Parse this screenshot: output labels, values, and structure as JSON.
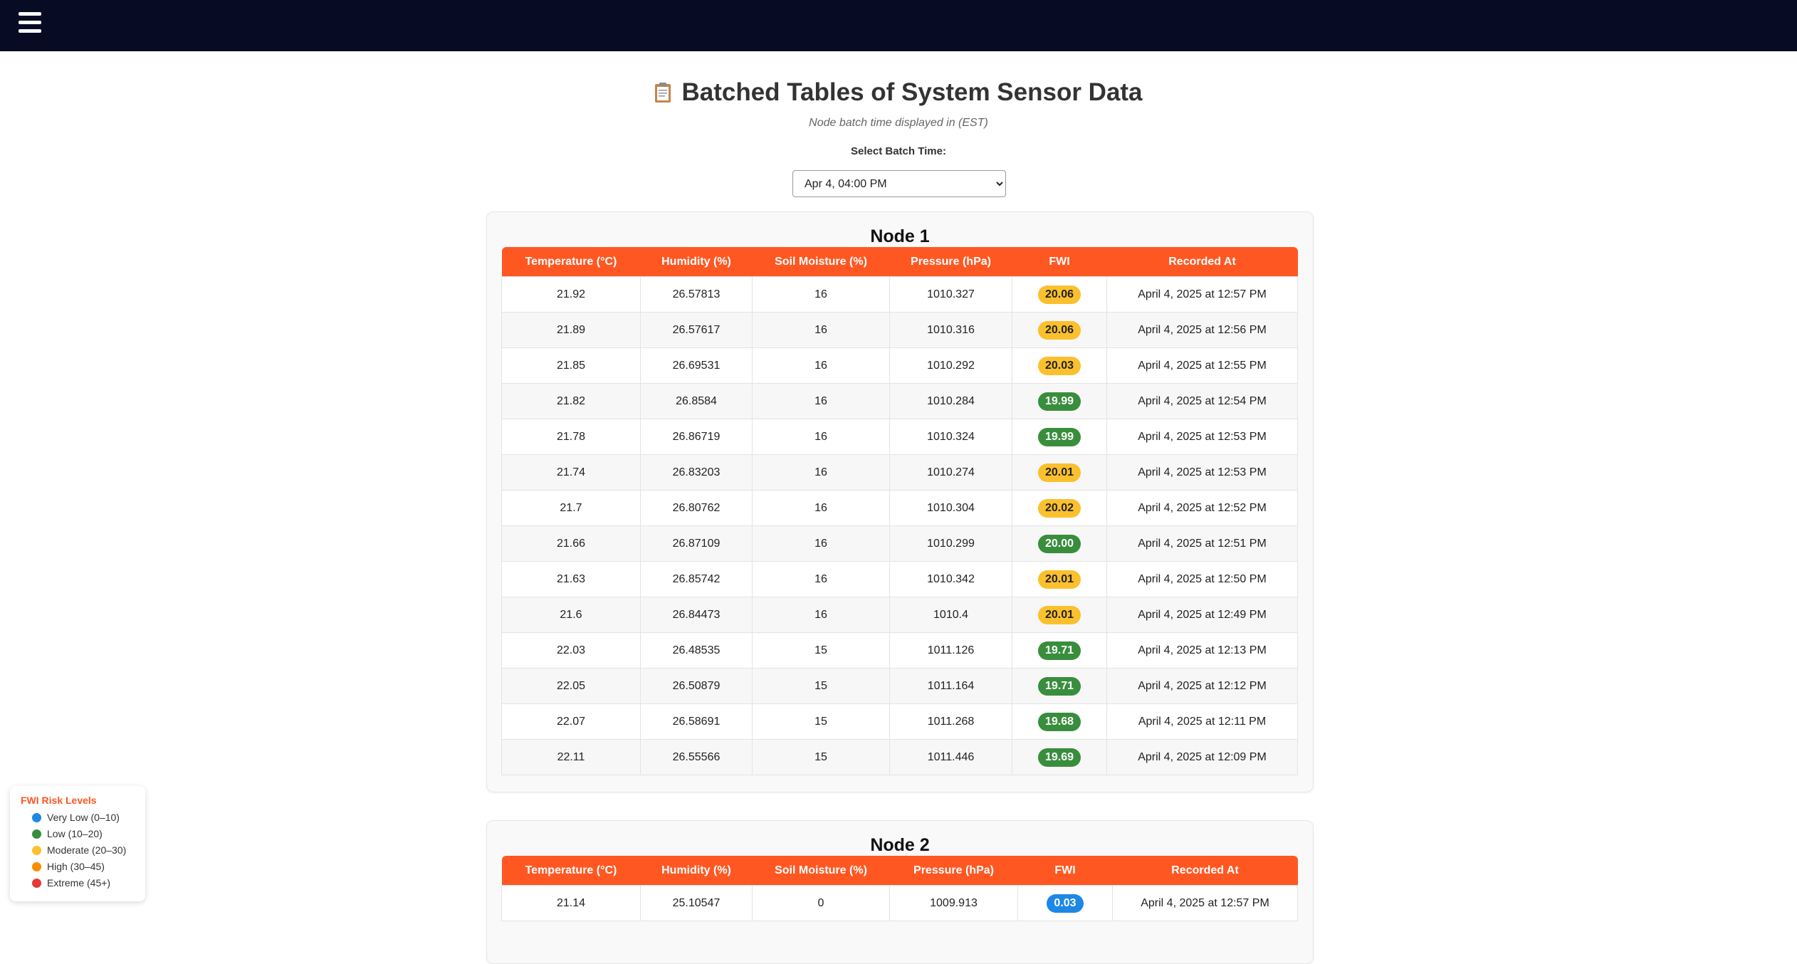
{
  "nav": {
    "menu_icon": "hamburger-menu-icon"
  },
  "header": {
    "title_icon": "clipboard-icon",
    "title": "Batched Tables of System Sensor Data",
    "subtitle": "Node batch time displayed in (EST)"
  },
  "batch": {
    "label": "Select Batch Time:",
    "selected": "Apr 4, 04:00 PM"
  },
  "columns": [
    "Temperature (°C)",
    "Humidity (%)",
    "Soil Moisture (%)",
    "Pressure (hPa)",
    "FWI",
    "Recorded At"
  ],
  "nodes": [
    {
      "title": "Node 1",
      "rows": [
        [
          "21.92",
          "26.57813",
          "16",
          "1010.327",
          "20.06",
          "April 4, 2025 at 12:57 PM"
        ],
        [
          "21.89",
          "26.57617",
          "16",
          "1010.316",
          "20.06",
          "April 4, 2025 at 12:56 PM"
        ],
        [
          "21.85",
          "26.69531",
          "16",
          "1010.292",
          "20.03",
          "April 4, 2025 at 12:55 PM"
        ],
        [
          "21.82",
          "26.8584",
          "16",
          "1010.284",
          "19.99",
          "April 4, 2025 at 12:54 PM"
        ],
        [
          "21.78",
          "26.86719",
          "16",
          "1010.324",
          "19.99",
          "April 4, 2025 at 12:53 PM"
        ],
        [
          "21.74",
          "26.83203",
          "16",
          "1010.274",
          "20.01",
          "April 4, 2025 at 12:53 PM"
        ],
        [
          "21.7",
          "26.80762",
          "16",
          "1010.304",
          "20.02",
          "April 4, 2025 at 12:52 PM"
        ],
        [
          "21.66",
          "26.87109",
          "16",
          "1010.299",
          "20.00",
          "April 4, 2025 at 12:51 PM"
        ],
        [
          "21.63",
          "26.85742",
          "16",
          "1010.342",
          "20.01",
          "April 4, 2025 at 12:50 PM"
        ],
        [
          "21.6",
          "26.84473",
          "16",
          "1010.4",
          "20.01",
          "April 4, 2025 at 12:49 PM"
        ],
        [
          "22.03",
          "26.48535",
          "15",
          "1011.126",
          "19.71",
          "April 4, 2025 at 12:13 PM"
        ],
        [
          "22.05",
          "26.50879",
          "15",
          "1011.164",
          "19.71",
          "April 4, 2025 at 12:12 PM"
        ],
        [
          "22.07",
          "26.58691",
          "15",
          "1011.268",
          "19.68",
          "April 4, 2025 at 12:11 PM"
        ],
        [
          "22.11",
          "26.55566",
          "15",
          "1011.446",
          "19.69",
          "April 4, 2025 at 12:09 PM"
        ]
      ],
      "fwi_levels": [
        "moderate",
        "moderate",
        "moderate",
        "low",
        "low",
        "moderate",
        "moderate",
        "low",
        "moderate",
        "moderate",
        "low",
        "low",
        "low",
        "low"
      ]
    },
    {
      "title": "Node 2",
      "rows": [
        [
          "21.14",
          "25.10547",
          "0",
          "1009.913",
          "0.03",
          "April 4, 2025 at 12:57 PM"
        ]
      ],
      "fwi_levels": [
        "verylow"
      ]
    }
  ],
  "legend": {
    "title": "FWI Risk Levels",
    "items": [
      {
        "label": "Very Low (0–10)",
        "color": "#1e88e5"
      },
      {
        "label": "Low (10–20)",
        "color": "#388e3c"
      },
      {
        "label": "Moderate (20–30)",
        "color": "#fbc02d"
      },
      {
        "label": "High (30–45)",
        "color": "#fb8c00"
      },
      {
        "label": "Extreme (45+)",
        "color": "#e53935"
      }
    ]
  }
}
